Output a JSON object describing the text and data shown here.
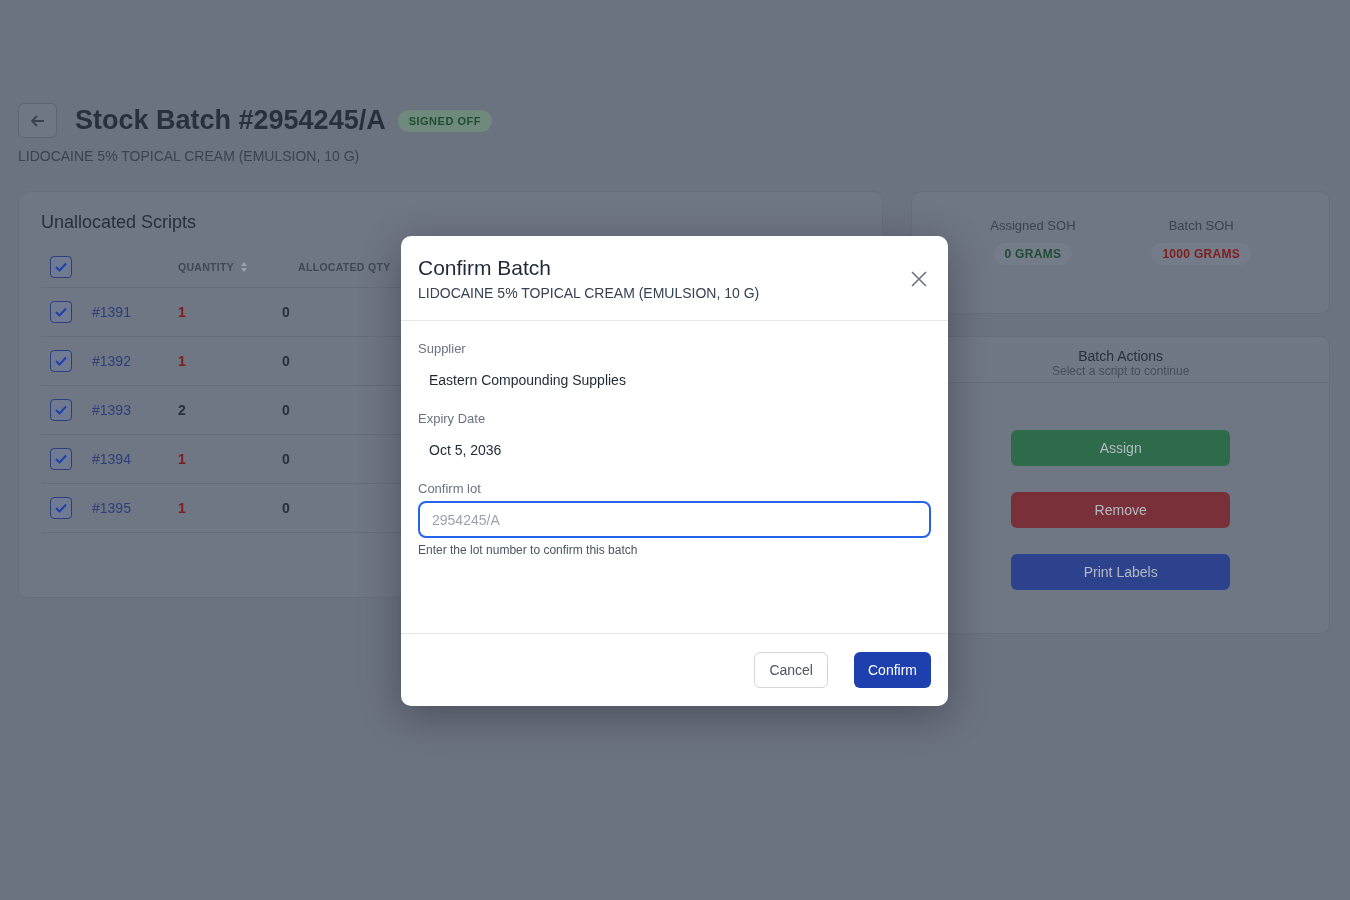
{
  "page": {
    "title": "Stock Batch #2954245/A",
    "status": "SIGNED OFF",
    "subtitle": "LIDOCAINE 5% TOPICAL CREAM (EMULSION, 10 G)"
  },
  "scripts": {
    "title": "Unallocated Scripts",
    "all_checked": true,
    "columns": [
      "QUANTITY",
      "ALLOCATED QTY"
    ],
    "rows": [
      {
        "id": "#1391",
        "checked": true,
        "quantity": "1",
        "color": "#7f1d1d",
        "allocated": "0"
      },
      {
        "id": "#1392",
        "checked": true,
        "quantity": "1",
        "color": "#7f1d1d",
        "allocated": "0"
      },
      {
        "id": "#1393",
        "checked": true,
        "quantity": "2",
        "color": "#27303d",
        "allocated": "0"
      },
      {
        "id": "#1394",
        "checked": true,
        "quantity": "1",
        "color": "#7f1d1d",
        "allocated": "0"
      },
      {
        "id": "#1395",
        "checked": true,
        "quantity": "1",
        "color": "#7f1d1d",
        "allocated": "0"
      }
    ]
  },
  "soh": [
    {
      "label": "Assigned SOH",
      "value": "0 GRAMS",
      "color": "#1f4d33"
    },
    {
      "label": "Batch SOH",
      "value": "1000 GRAMS",
      "color": "#7f1d1d"
    }
  ],
  "actions": {
    "title": "Batch Actions",
    "hint": "Select a script to continue",
    "buttons": [
      {
        "label": "Assign",
        "kind": "assign"
      },
      {
        "label": "Remove",
        "kind": "remove"
      },
      {
        "label": "Print Labels",
        "kind": "print"
      }
    ]
  },
  "dialog": {
    "title": "Confirm Batch",
    "subtitle": "LIDOCAINE 5% TOPICAL CREAM (EMULSION, 10 G)",
    "fields": [
      {
        "label": "Supplier",
        "value": "Eastern Compounding Supplies"
      },
      {
        "label": "Expiry Date",
        "value": "Oct 5, 2036"
      }
    ],
    "lot": {
      "label": "Confirm lot",
      "placeholder": "2954245/A",
      "help": "Enter the lot number to confirm this batch"
    },
    "cancel": "Cancel",
    "confirm": "Confirm"
  }
}
